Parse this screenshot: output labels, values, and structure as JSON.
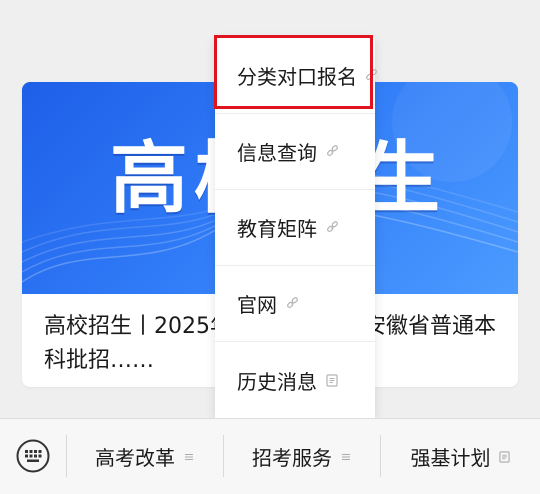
{
  "article": {
    "banner_title": "高校招生",
    "headline": "高校招生丨2025年……将首次在安徽省普通本科批招……"
  },
  "menu": {
    "items": [
      {
        "label": "分类对口报名",
        "icon": "link-icon"
      },
      {
        "label": "信息查询",
        "icon": "link-icon"
      },
      {
        "label": "教育矩阵",
        "icon": "link-icon"
      },
      {
        "label": "官网",
        "icon": "link-icon"
      },
      {
        "label": "历史消息",
        "icon": "document-icon"
      }
    ]
  },
  "bottom_bar": {
    "keyboard_icon": "keyboard-icon",
    "tabs": [
      {
        "label": "高考改革",
        "icon": "menu-lines-icon"
      },
      {
        "label": "招考服务",
        "icon": "menu-lines-icon"
      },
      {
        "label": "强基计划",
        "icon": "document-icon"
      }
    ]
  },
  "colors": {
    "highlight": "#e0141e",
    "banner_blue": "#2f7af7"
  }
}
